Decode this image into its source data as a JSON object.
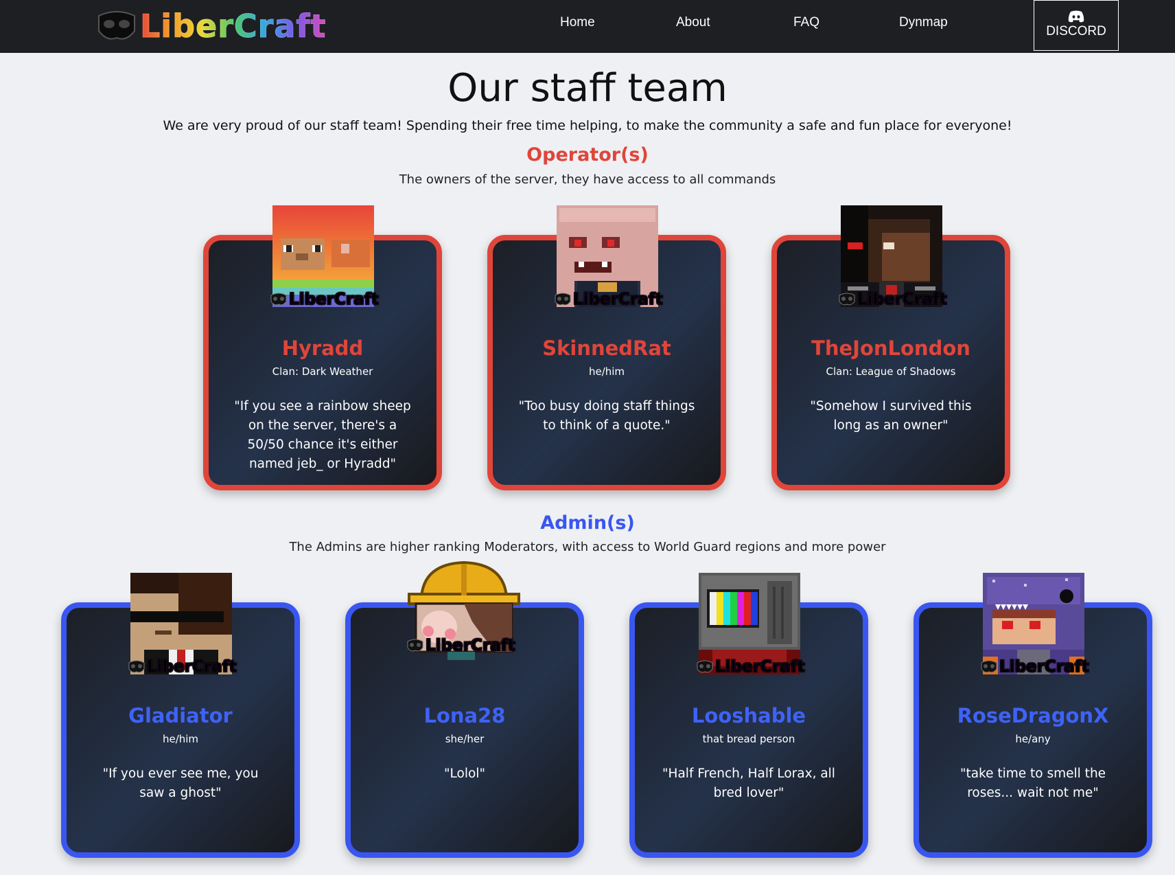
{
  "nav": {
    "logo_text": "LiberCraft",
    "links": [
      "Home",
      "About",
      "FAQ",
      "Dynmap"
    ],
    "discord_label": "DISCORD"
  },
  "page": {
    "title": "Our staff team",
    "subtitle": "We are very proud of our staff team! Spending their free time helping, to make the community a safe and fun place for everyone!"
  },
  "badge_text": "LiberCraft",
  "operators": {
    "title": "Operator(s)",
    "description": "The owners of the server, they have access to all commands",
    "color": "#e0453a",
    "members": [
      {
        "name": "Hyradd",
        "info": "Clan: Dark Weather",
        "quote": "\"If you see a rainbow sheep on the server, there's a 50/50 chance it's either named jeb_ or Hyradd\""
      },
      {
        "name": "SkinnedRat",
        "info": "he/him",
        "quote": "\"Too busy doing staff things to think of a quote.\""
      },
      {
        "name": "TheJonLondon",
        "info": "Clan: League of Shadows",
        "quote": "\"Somehow I survived this long as an owner\""
      }
    ]
  },
  "admins": {
    "title": "Admin(s)",
    "description": "The Admins are higher ranking Moderators, with access to World Guard regions and more power",
    "color": "#3a56f0",
    "members": [
      {
        "name": "Gladiator",
        "info": "he/him",
        "quote": "\"If you ever see me, you saw a ghost\""
      },
      {
        "name": "Lona28",
        "info": "she/her",
        "quote": "\"Lolol\""
      },
      {
        "name": "Looshable",
        "info": "that bread person",
        "quote": "\"Half French, Half Lorax, all bred lover\""
      },
      {
        "name": "RoseDragonX",
        "info": "he/any",
        "quote": "\"take time to smell the roses... wait not me\""
      }
    ]
  }
}
